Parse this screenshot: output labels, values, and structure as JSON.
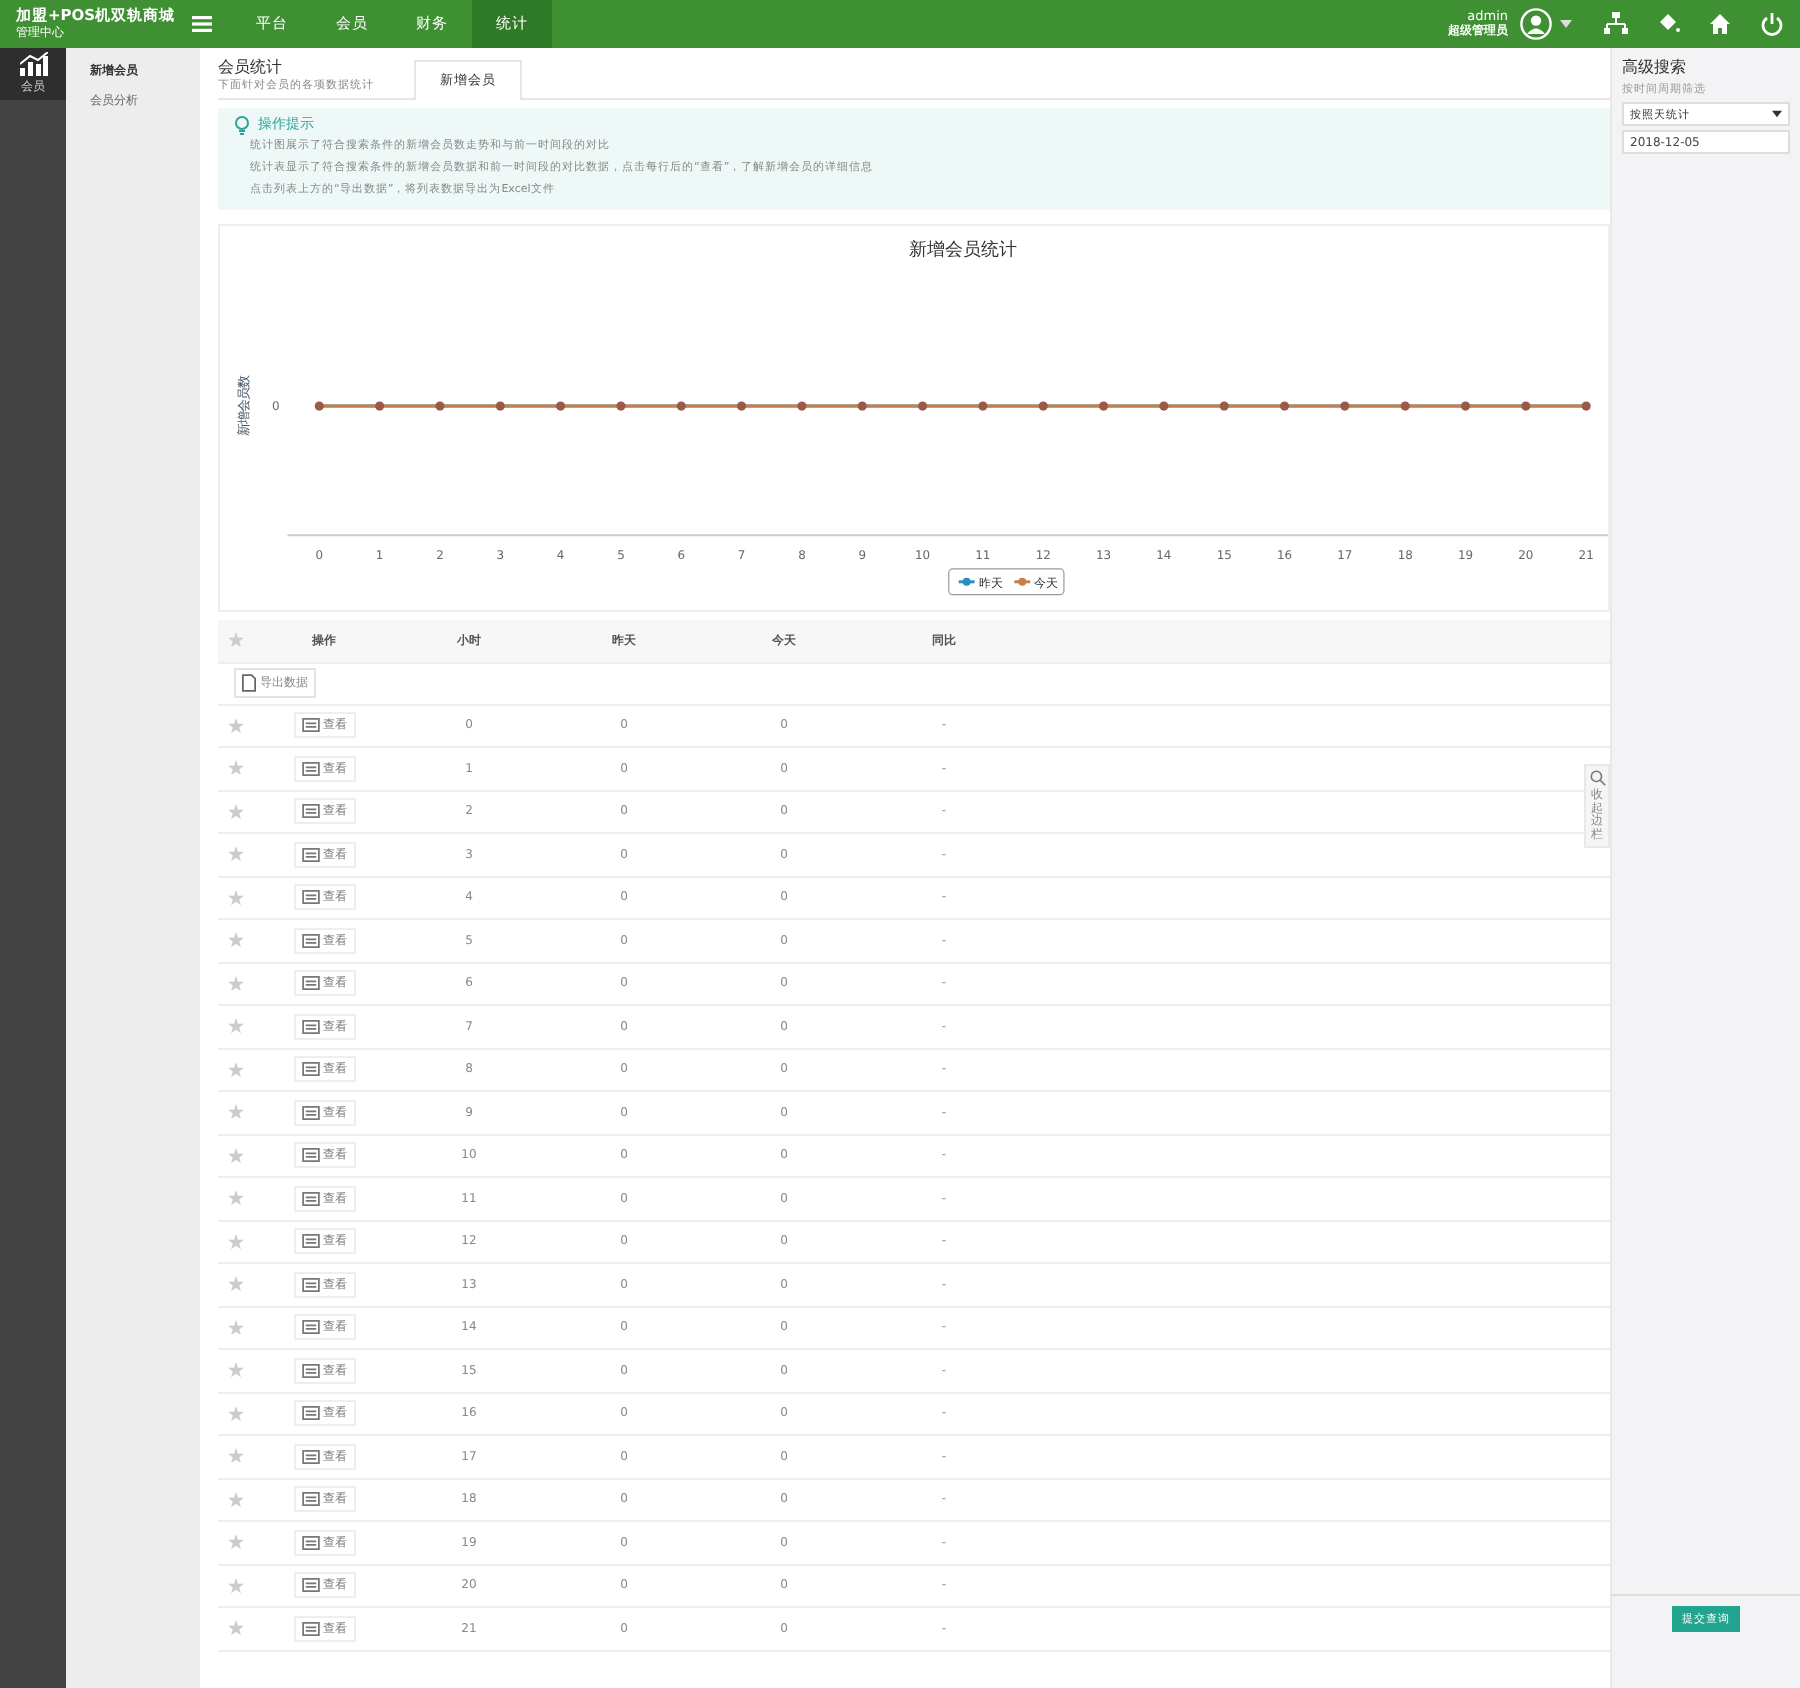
{
  "header": {
    "logo_title": "加盟+POS机双轨商城",
    "logo_subtitle": "管理中心",
    "nav": [
      {
        "label": "平台",
        "selected": false
      },
      {
        "label": "会员",
        "selected": false
      },
      {
        "label": "财务",
        "selected": false
      },
      {
        "label": "统计",
        "selected": true
      }
    ],
    "user": {
      "name": "admin",
      "role": "超级管理员"
    }
  },
  "sidebar": {
    "items": [
      {
        "label": "会员",
        "selected": true
      }
    ]
  },
  "submenu": {
    "items": [
      {
        "label": "新增会员",
        "selected": true
      },
      {
        "label": "会员分析",
        "selected": false
      }
    ]
  },
  "page": {
    "title": "会员统计",
    "subtitle": "下面针对会员的各项数据统计",
    "tabs": [
      {
        "label": "新增会员",
        "selected": true
      }
    ]
  },
  "tips": {
    "title": "操作提示",
    "items": [
      "统计图展示了符合搜索条件的新增会员数走势和与前一时间段的对比",
      "统计表显示了符合搜索条件的新增会员数据和前一时间段的对比数据，点击每行后的“查看”，了解新增会员的详细信息",
      "点击列表上方的“导出数据”，将列表数据导出为Excel文件"
    ]
  },
  "chart": {
    "title": "新增会员统计",
    "ylabel": "新增会员数",
    "y_tick": "0",
    "x_labels": [
      "0",
      "1",
      "2",
      "3",
      "4",
      "5",
      "6",
      "7",
      "8",
      "9",
      "10",
      "11",
      "12",
      "13",
      "14",
      "15",
      "16",
      "17",
      "18",
      "19",
      "20",
      "21"
    ],
    "legend": [
      {
        "name": "昨天",
        "color": "#2b8cbe"
      },
      {
        "name": "今天",
        "color": "#c8804a"
      }
    ]
  },
  "table": {
    "columns": [
      "操作",
      "小时",
      "昨天",
      "今天",
      "同比"
    ],
    "export_button": "导出数据",
    "rows": [
      {
        "action": "查看",
        "hour": "0",
        "yesterday": "0",
        "today": "0",
        "change": "-"
      },
      {
        "action": "查看",
        "hour": "1",
        "yesterday": "0",
        "today": "0",
        "change": "-"
      },
      {
        "action": "查看",
        "hour": "2",
        "yesterday": "0",
        "today": "0",
        "change": "-"
      },
      {
        "action": "查看",
        "hour": "3",
        "yesterday": "0",
        "today": "0",
        "change": "-"
      },
      {
        "action": "查看",
        "hour": "4",
        "yesterday": "0",
        "today": "0",
        "change": "-"
      },
      {
        "action": "查看",
        "hour": "5",
        "yesterday": "0",
        "today": "0",
        "change": "-"
      },
      {
        "action": "查看",
        "hour": "6",
        "yesterday": "0",
        "today": "0",
        "change": "-"
      },
      {
        "action": "查看",
        "hour": "7",
        "yesterday": "0",
        "today": "0",
        "change": "-"
      },
      {
        "action": "查看",
        "hour": "8",
        "yesterday": "0",
        "today": "0",
        "change": "-"
      },
      {
        "action": "查看",
        "hour": "9",
        "yesterday": "0",
        "today": "0",
        "change": "-"
      },
      {
        "action": "查看",
        "hour": "10",
        "yesterday": "0",
        "today": "0",
        "change": "-"
      },
      {
        "action": "查看",
        "hour": "11",
        "yesterday": "0",
        "today": "0",
        "change": "-"
      },
      {
        "action": "查看",
        "hour": "12",
        "yesterday": "0",
        "today": "0",
        "change": "-"
      },
      {
        "action": "查看",
        "hour": "13",
        "yesterday": "0",
        "today": "0",
        "change": "-"
      },
      {
        "action": "查看",
        "hour": "14",
        "yesterday": "0",
        "today": "0",
        "change": "-"
      },
      {
        "action": "查看",
        "hour": "15",
        "yesterday": "0",
        "today": "0",
        "change": "-"
      },
      {
        "action": "查看",
        "hour": "16",
        "yesterday": "0",
        "today": "0",
        "change": "-"
      },
      {
        "action": "查看",
        "hour": "17",
        "yesterday": "0",
        "today": "0",
        "change": "-"
      },
      {
        "action": "查看",
        "hour": "18",
        "yesterday": "0",
        "today": "0",
        "change": "-"
      },
      {
        "action": "查看",
        "hour": "19",
        "yesterday": "0",
        "today": "0",
        "change": "-"
      },
      {
        "action": "查看",
        "hour": "20",
        "yesterday": "0",
        "today": "0",
        "change": "-"
      },
      {
        "action": "查看",
        "hour": "21",
        "yesterday": "0",
        "today": "0",
        "change": "-"
      }
    ]
  },
  "collapse_tab": "收起边栏",
  "search_panel": {
    "title": "高级搜索",
    "filter_label": "按时间周期筛选",
    "period": "按照天统计",
    "date": "2018-12-05",
    "submit": "提交查询"
  }
}
